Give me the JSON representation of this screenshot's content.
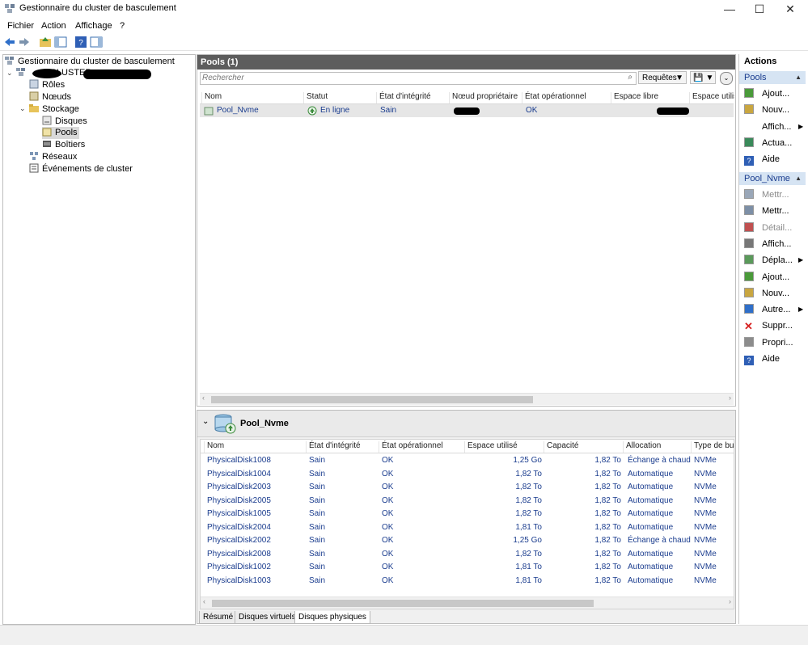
{
  "window": {
    "title": "Gestionnaire du cluster de basculement",
    "minimize": "—",
    "maximize": "☐",
    "close": "✕"
  },
  "menu": [
    "Fichier",
    "Action",
    "Affichage",
    "?"
  ],
  "tree": {
    "root": "Gestionnaire du cluster de basculement",
    "cluster": "CLUSTER",
    "roles": "Rôles",
    "nodes": "Nœuds",
    "storage": "Stockage",
    "disks": "Disques",
    "pools": "Pools",
    "enclosures": "Boîtiers",
    "networks": "Réseaux",
    "events": "Événements de cluster"
  },
  "pools_panel": {
    "title": "Pools (1)",
    "search_placeholder": "Rechercher",
    "queries_label": "Requêtes",
    "columns": [
      "Nom",
      "Statut",
      "État d'intégrité",
      "Nœud propriétaire",
      "État opérationnel",
      "Espace libre",
      "Espace utilisé"
    ],
    "row": {
      "name": "Pool_Nvme",
      "status": "En ligne",
      "health": "Sain",
      "op": "OK"
    }
  },
  "detail_panel": {
    "title": "Pool_Nvme",
    "columns": [
      "Nom",
      "État d'intégrité",
      "État opérationnel",
      "Espace utilisé",
      "Capacité",
      "Allocation",
      "Type de bus"
    ],
    "rows": [
      [
        "PhysicalDisk1008",
        "Sain",
        "OK",
        "1,25 Go",
        "1,82 To",
        "Échange à chaud",
        "NVMe"
      ],
      [
        "PhysicalDisk1004",
        "Sain",
        "OK",
        "1,82 To",
        "1,82 To",
        "Automatique",
        "NVMe"
      ],
      [
        "PhysicalDisk2003",
        "Sain",
        "OK",
        "1,82 To",
        "1,82 To",
        "Automatique",
        "NVMe"
      ],
      [
        "PhysicalDisk2005",
        "Sain",
        "OK",
        "1,82 To",
        "1,82 To",
        "Automatique",
        "NVMe"
      ],
      [
        "PhysicalDisk1005",
        "Sain",
        "OK",
        "1,82 To",
        "1,82 To",
        "Automatique",
        "NVMe"
      ],
      [
        "PhysicalDisk2004",
        "Sain",
        "OK",
        "1,81 To",
        "1,82 To",
        "Automatique",
        "NVMe"
      ],
      [
        "PhysicalDisk2002",
        "Sain",
        "OK",
        "1,25 Go",
        "1,82 To",
        "Échange à chaud",
        "NVMe"
      ],
      [
        "PhysicalDisk2008",
        "Sain",
        "OK",
        "1,82 To",
        "1,82 To",
        "Automatique",
        "NVMe"
      ],
      [
        "PhysicalDisk1002",
        "Sain",
        "OK",
        "1,81 To",
        "1,82 To",
        "Automatique",
        "NVMe"
      ],
      [
        "PhysicalDisk1003",
        "Sain",
        "OK",
        "1,81 To",
        "1,82 To",
        "Automatique",
        "NVMe"
      ]
    ],
    "tabs": [
      "Résumé",
      "Disques virtuels",
      "Disques physiques"
    ]
  },
  "actions": {
    "title": "Actions",
    "section1": "Pools",
    "section1_items": [
      "Ajout...",
      "Nouv...",
      "Affich...",
      "Actua...",
      "Aide"
    ],
    "section2": "Pool_Nvme",
    "section2_items": [
      "Mettr...",
      "Mettr...",
      "Détail...",
      "Affich...",
      "Dépla...",
      "Ajout...",
      "Nouv...",
      "Autre...",
      "Suppr...",
      "Propri...",
      "Aide"
    ]
  },
  "colors": {
    "accent_blue": "#1a3c8e",
    "section_bg": "#d6e4f3",
    "panel_header": "#5d5d5d"
  }
}
